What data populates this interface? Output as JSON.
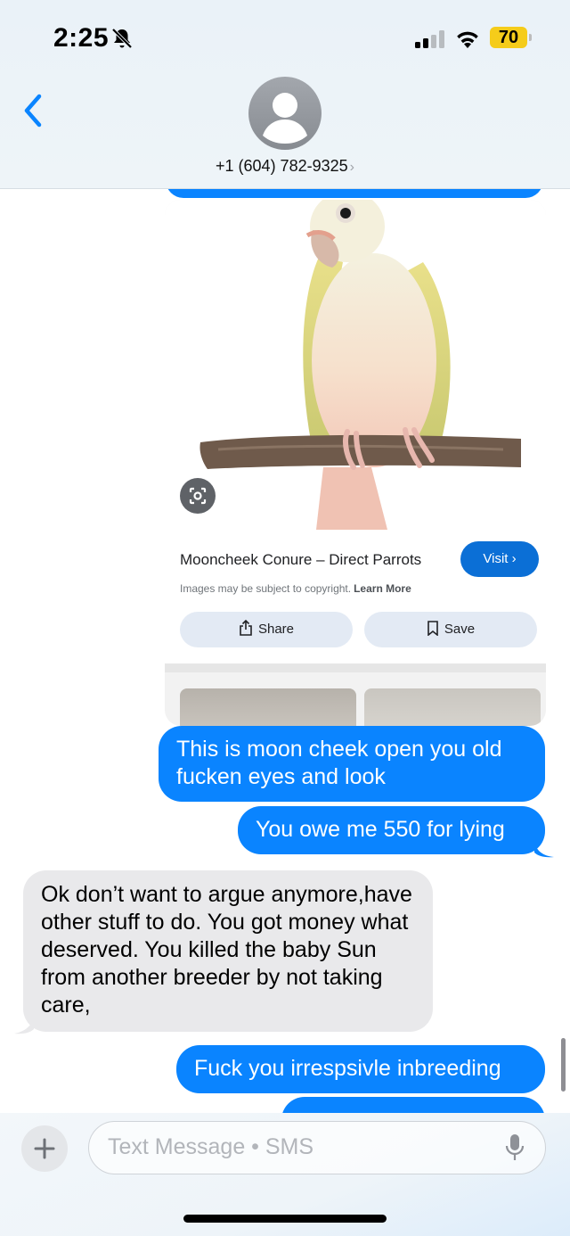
{
  "status_bar": {
    "time": "2:25",
    "battery": "70",
    "icons": [
      "bell-slash-icon",
      "cellular-signal-icon",
      "wifi-icon",
      "battery-icon"
    ],
    "battery_color": "#f5cc1a"
  },
  "header": {
    "back_icon": "chevron-left-icon",
    "contact": "+1 (604) 782-9325",
    "contact_chevron": "›",
    "accent_color": "#0a84ff"
  },
  "search_card": {
    "image_subject": "parrot-photo",
    "title": "Mooncheek Conure – Direct Parrots",
    "visit_label": "Visit",
    "visit_chevron": "›",
    "copyright": "Images may be subject to copyright.",
    "learn_more": "Learn More",
    "share_label": "Share",
    "save_label": "Save"
  },
  "messages": [
    {
      "direction": "outgoing",
      "text": "This is moon cheek open you old fucken eyes and look"
    },
    {
      "direction": "outgoing",
      "text": "You owe me 550 for lying"
    },
    {
      "direction": "incoming",
      "text": "Ok don’t want to argue anymore,have other stuff to do. You  got money what deserved. You killed the baby Sun from another breeder by not taking care,"
    },
    {
      "direction": "outgoing",
      "text": "Fuck you irrespsivle inbreeding"
    }
  ],
  "composer": {
    "placeholder": "Text Message • SMS",
    "plus_icon": "plus-icon",
    "mic_icon": "microphone-icon"
  },
  "colors": {
    "outgoing_bubble": "#0a84ff",
    "incoming_bubble": "#e9e9eb"
  }
}
